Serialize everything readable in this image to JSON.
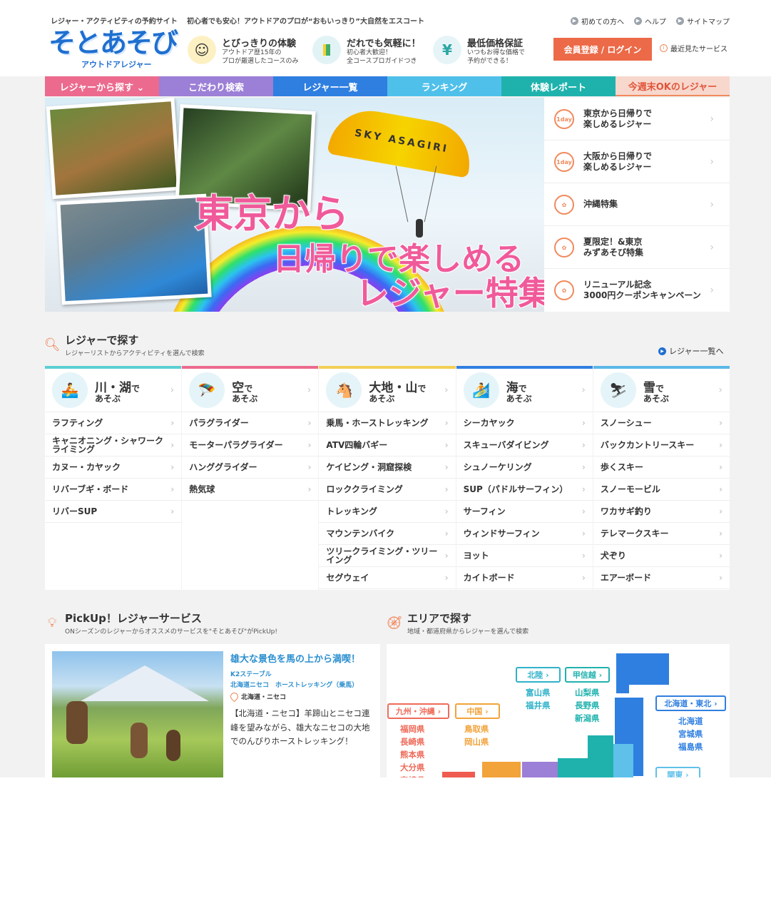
{
  "header": {
    "tagline1": "レジャー・アクティビティの予約サイト",
    "tagline2": "初心者でも安心！アウトドアのプロが“おもいっきり”大自然をエスコート",
    "logo_main": "そとあそび",
    "logo_sub": "アウトドアレジャー",
    "features": [
      {
        "icon": "smile-icon",
        "title": "とびっきりの体験",
        "desc1": "アウトドア歴15年の",
        "desc2": "プロが厳選したコースのみ"
      },
      {
        "icon": "beginner-mark-icon",
        "title": "だれでも気軽に！",
        "desc1": "初心者大歓迎！",
        "desc2": "全コースプロガイドつき"
      },
      {
        "icon": "yen-icon",
        "title": "最低価格保証",
        "desc1": "いつもお得な価格で",
        "desc2": "予約ができる！"
      }
    ],
    "links": [
      "初めての方へ",
      "ヘルプ",
      "サイトマップ"
    ],
    "login": "会員登録 / ログイン",
    "recent": "最近見たサービス"
  },
  "nav": [
    {
      "label": "レジャーから探す ⌄",
      "color": "#ec6a8e"
    },
    {
      "label": "こだわり検索",
      "color": "#9c7fd6"
    },
    {
      "label": "レジャー一覧",
      "color": "#2f7fe0"
    },
    {
      "label": "ランキング",
      "color": "#4fc0ea"
    },
    {
      "label": "体験レポート",
      "color": "#1fb2ad"
    },
    {
      "label": "今週末OKのレジャー",
      "color": "#f8d7cd",
      "text": "#e0563a"
    }
  ],
  "hero": {
    "glider_text": "SKY ASAGIRI",
    "line1": "東京から",
    "line2": "日帰りで楽しめる",
    "line3": "レジャー特集!"
  },
  "side_links": [
    {
      "icon": "1day",
      "label": "東京から日帰りで\n楽しめるレジャー"
    },
    {
      "icon": "1day",
      "label": "大阪から日帰りで\n楽しめるレジャー"
    },
    {
      "icon": "award",
      "label": "沖縄特集"
    },
    {
      "icon": "award",
      "label": "夏限定！&東京\nみずあそび特集"
    },
    {
      "icon": "award",
      "label": "リニューアル記念\n3000円クーポンキャンペーン"
    }
  ],
  "search": {
    "title": "レジャーで探す",
    "subtitle": "レジャーリストからアクティビティを選んで検索",
    "more": "レジャー一覧へ"
  },
  "categories": [
    {
      "name": "川・湖",
      "de": "で",
      "sub": "あそぶ",
      "color": "#5ccfd3",
      "icon": "🚣",
      "items": [
        "ラフティング",
        "キャニオニング・シャワークライミング",
        "カヌー・カヤック",
        "リバーブギ・ボード",
        "リバーSUP"
      ]
    },
    {
      "name": "空",
      "de": "で",
      "sub": "あそぶ",
      "color": "#ec6a8e",
      "icon": "🪂",
      "items": [
        "パラグライダー",
        "モーターパラグライダー",
        "ハンググライダー",
        "熱気球"
      ]
    },
    {
      "name": "大地・山",
      "de": "で",
      "sub": "あそぶ",
      "color": "#f2cf55",
      "icon": "🐴",
      "items": [
        "乗馬・ホーストレッキング",
        "ATV四輪バギー",
        "ケイビング・洞窟探検",
        "ロッククライミング",
        "トレッキング",
        "マウンテンバイク",
        "ツリークライミング・ツリーイング",
        "セグウェイ"
      ]
    },
    {
      "name": "海",
      "de": "で",
      "sub": "あそぶ",
      "color": "#2f7fe0",
      "icon": "🏄",
      "items": [
        "シーカヤック",
        "スキューバダイビング",
        "シュノーケリング",
        "SUP（パドルサーフィン）",
        "サーフィン",
        "ウィンドサーフィン",
        "ヨット",
        "カイトボード"
      ]
    },
    {
      "name": "雪",
      "de": "で",
      "sub": "あそぶ",
      "color": "#5ab8e8",
      "icon": "⛷",
      "items": [
        "スノーシュー",
        "バックカントリースキー",
        "歩くスキー",
        "スノーモービル",
        "ワカサギ釣り",
        "テレマークスキー",
        "犬ぞり",
        "エアーボード"
      ]
    }
  ],
  "pickup": {
    "title": "PickUp！レジャーサービス",
    "subtitle": "ONシーズンのレジャーからオススメのサービスを\"そとあそび\"がPickUp!",
    "card_title": "雄大な景色を馬の上から満喫！",
    "provider": "K2ステーブル",
    "category": "北海道ニセコ　ホーストレッキング（乗馬）",
    "location": "北海道・ニセコ",
    "desc": "【北海道・ニセコ】羊蹄山とニセコ連峰を望みながら、雄大なニセコの大地でのんびりホーストレッキング！"
  },
  "area": {
    "title": "エリアで探す",
    "subtitle": "地域・都道府県からレジャーを選んで検索",
    "regions": {
      "kyushu": {
        "label": "九州・沖縄",
        "prefs": "福岡県\n長崎県\n熊本県\n大分県\n宮崎県"
      },
      "chugoku": {
        "label": "中国",
        "prefs": "鳥取県\n岡山県"
      },
      "hokuriku": {
        "label": "北陸",
        "prefs": "富山県\n福井県"
      },
      "koshinetsu": {
        "label": "甲信越",
        "prefs": "山梨県\n長野県\n新潟県"
      },
      "tohoku": {
        "label": "北海道・東北",
        "prefs": "北海道\n宮城県\n福島県"
      },
      "kanto": {
        "label": "関東"
      }
    }
  }
}
